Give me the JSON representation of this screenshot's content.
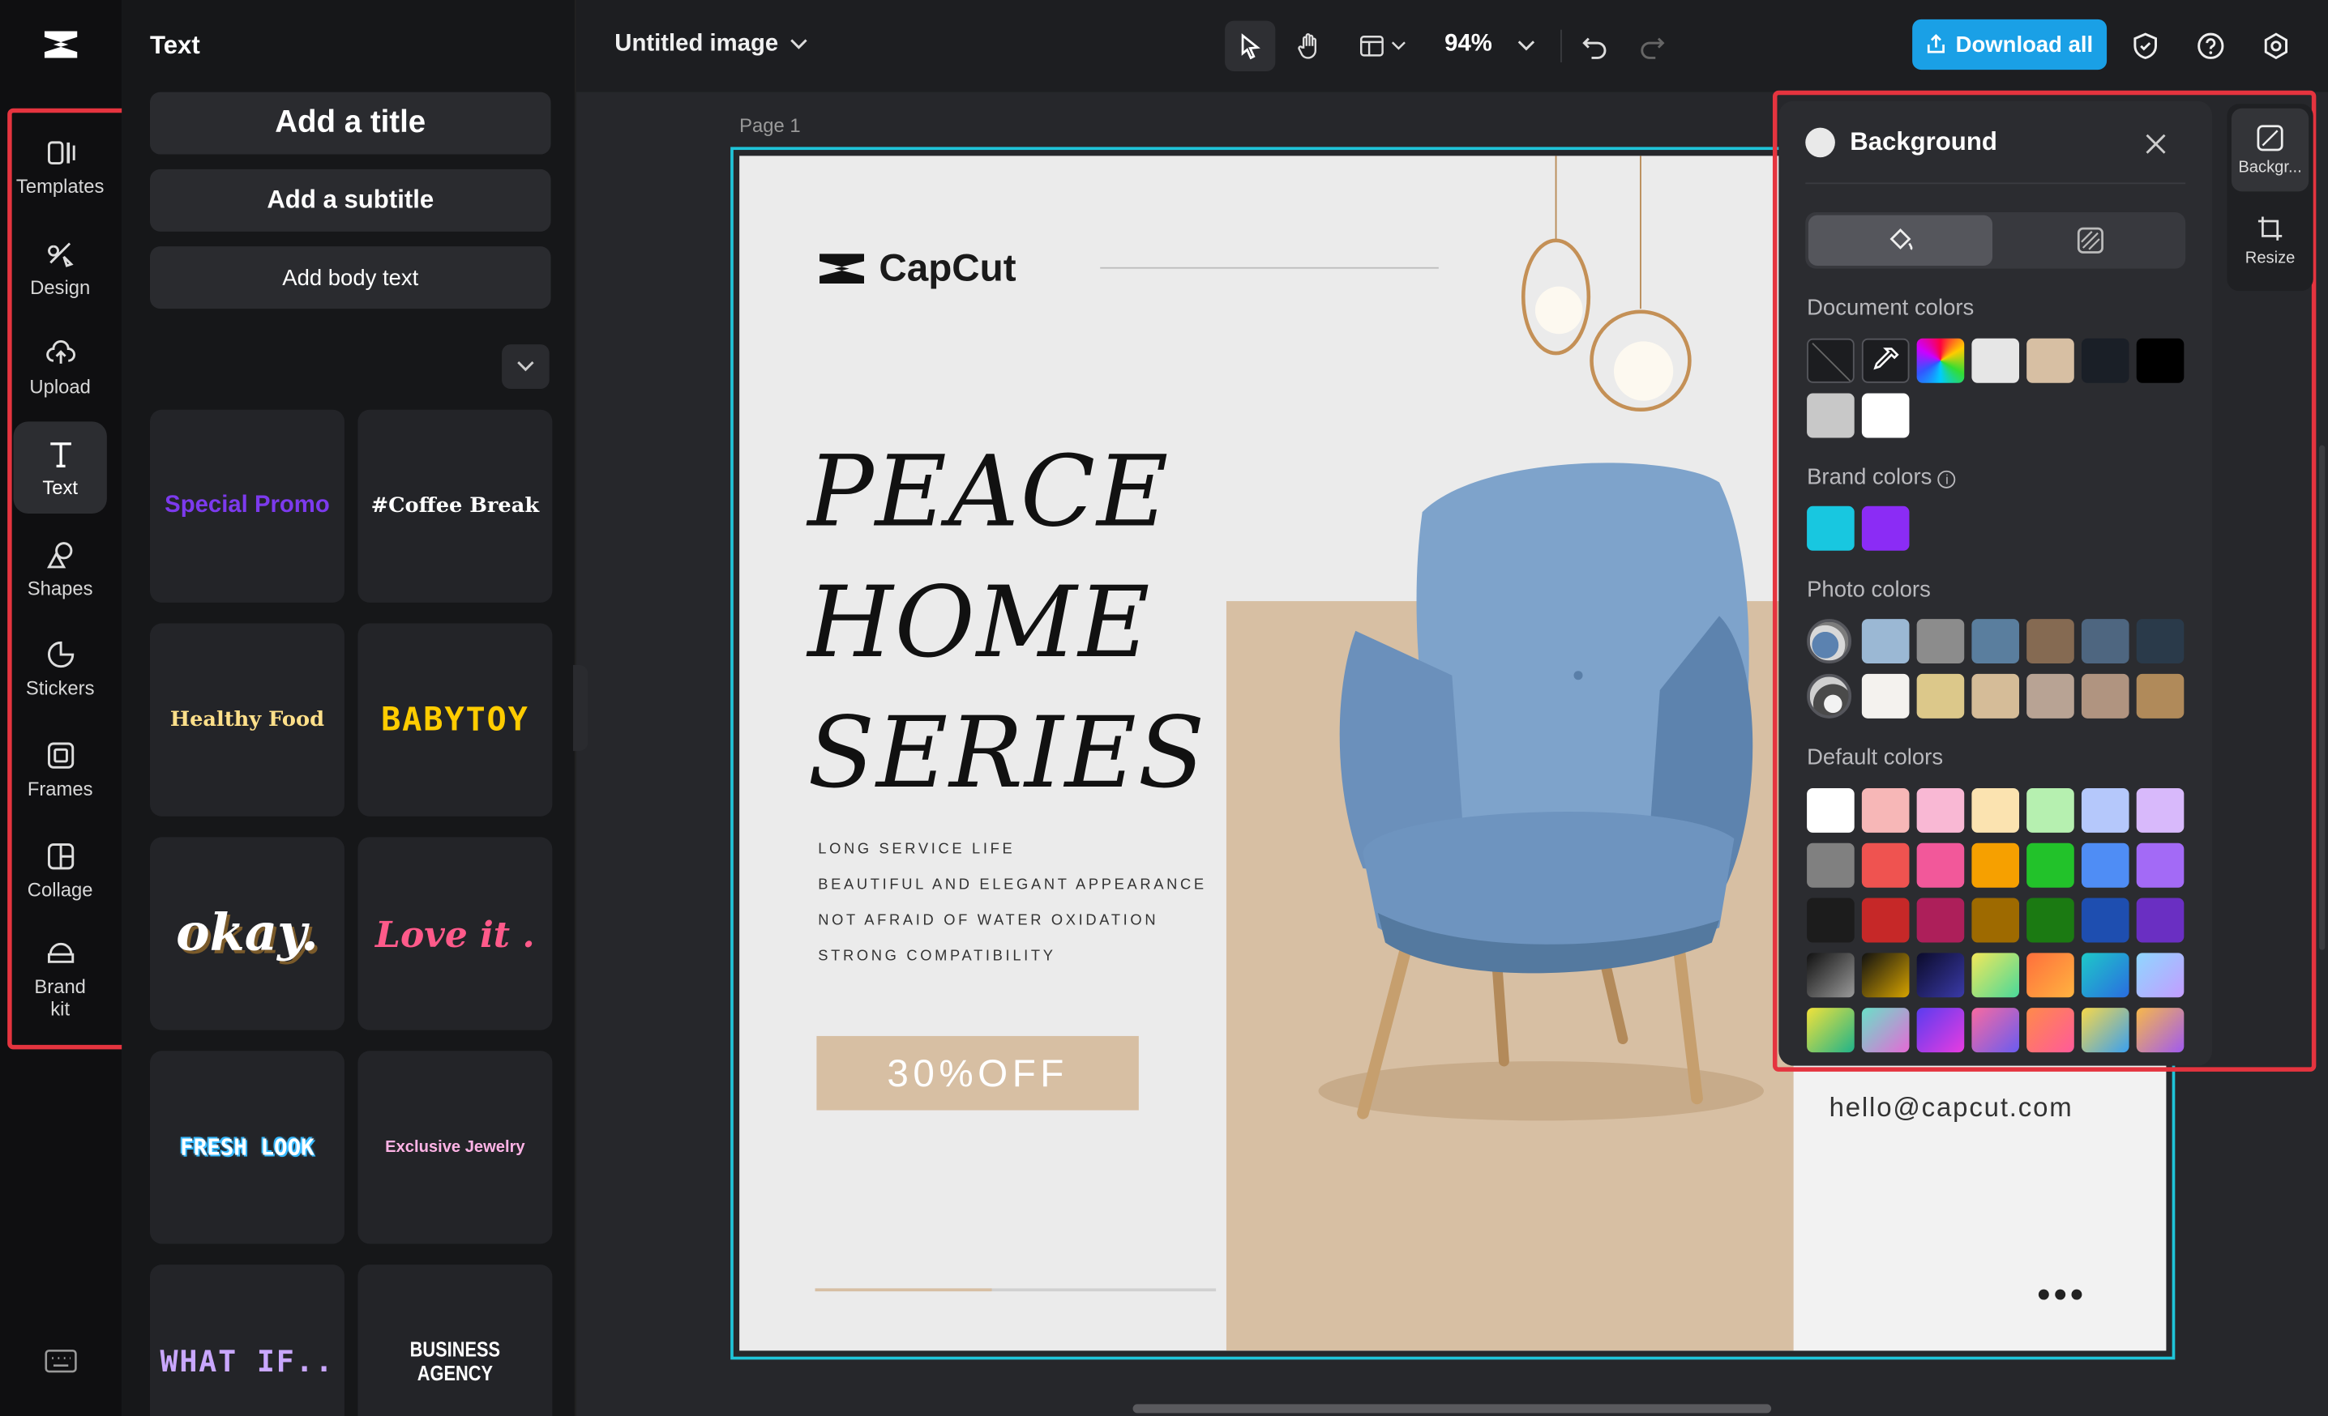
{
  "rail": {
    "items": [
      {
        "label": "Templates",
        "icon": "templates-icon"
      },
      {
        "label": "Design",
        "icon": "design-icon"
      },
      {
        "label": "Upload",
        "icon": "upload-icon"
      },
      {
        "label": "Text",
        "icon": "text-icon"
      },
      {
        "label": "Shapes",
        "icon": "shapes-icon"
      },
      {
        "label": "Stickers",
        "icon": "stickers-icon"
      },
      {
        "label": "Frames",
        "icon": "frames-icon"
      },
      {
        "label": "Collage",
        "icon": "collage-icon"
      },
      {
        "label": "Brand\nkit",
        "icon": "brand-kit-icon"
      }
    ],
    "active": "Text"
  },
  "text_panel": {
    "title": "Text",
    "add_title": "Add a title",
    "add_subtitle": "Add a subtitle",
    "add_body": "Add body text",
    "presets": [
      {
        "label": "Special Promo",
        "color": "#7c3aed"
      },
      {
        "label": "#Coffee Break",
        "color": "#ffffff"
      },
      {
        "label": "Healthy Food",
        "color": "#ffe08a"
      },
      {
        "label": "BABYTOY",
        "color": "#ffcc00"
      },
      {
        "label": "okay.",
        "color": "#ffffff"
      },
      {
        "label": "Love it .",
        "color": "#ff5a8a"
      },
      {
        "label": "FRESH LOOK",
        "color": "#7fe3ff"
      },
      {
        "label": "Exclusive Jewelry",
        "color": "#ffb3e6"
      },
      {
        "label": "WHAT IF..",
        "color": "#c9a7ff"
      },
      {
        "label": "BUSINESS AGENCY",
        "color": "#ffffff"
      }
    ]
  },
  "topbar": {
    "doc_title": "Untitled image",
    "zoom": "94%",
    "download_label": "Download all",
    "accent": "#1aa0e6"
  },
  "canvas": {
    "page_label": "Page 1",
    "brand_name": "CapCut",
    "headline": [
      "PEACE",
      "HOME",
      "SERIES"
    ],
    "features": [
      "LONG SERVICE LIFE",
      "BEAUTIFUL AND ELEGANT APPEARANCE",
      "NOT AFRAID OF WATER OXIDATION",
      "STRONG COMPATIBILITY"
    ],
    "offer": "30%OFF",
    "email": "hello@capcut.com",
    "more": "•••",
    "progress": 0.44
  },
  "background_panel": {
    "title": "Background",
    "document_colors_label": "Document colors",
    "document_colors": [
      "none",
      "picker",
      "rainbow",
      "#e6e6e6",
      "#d7bfa3",
      "#1a1f27",
      "#000000",
      "#c8c8c8",
      "#ffffff"
    ],
    "brand_colors_label": "Brand colors",
    "brand_colors": [
      "#18c7e0",
      "#8b2cf5"
    ],
    "photo_colors_label": "Photo colors",
    "photo_colors": [
      [
        "photo",
        "#9bb8d4",
        "#8c8c8c",
        "#5a7e9e",
        "#856a52",
        "#4e6680",
        "#2a3a4a"
      ],
      [
        "photo2",
        "#f4f2ee",
        "#dcc88a",
        "#d5bc98",
        "#b8a394",
        "#b09480",
        "#b08a5a"
      ]
    ],
    "default_colors_label": "Default colors",
    "default_colors": [
      [
        "#ffffff",
        "#f7b7b7",
        "#f9b8d4",
        "#fbe3b0",
        "#b6f0b0",
        "#b5c8fb",
        "#d8b9fb"
      ],
      [
        "#808080",
        "#ef5350",
        "#f2589a",
        "#f6a000",
        "#22c22a",
        "#4f8df5",
        "#a36af6"
      ],
      [
        "#1c1c1c",
        "#c62828",
        "#ad1f5a",
        "#9e6a00",
        "#1b7a12",
        "#1e4eb0",
        "#6a2fc2"
      ],
      [
        "g:#111111,#9a9a9a",
        "g:#111111,#d6a300",
        "g:#0b0b2a,#3a3aa8",
        "g:#f2e85a,#4ad89a",
        "g:#ff6f3c,#ffb340",
        "g:#1ec8c8,#2a6de0",
        "g:#8fd7ff,#c39cff"
      ],
      [
        "g:#f2e23a,#1fb38a",
        "g:#6ae0c8,#e46ad6",
        "g:#5a3cf0,#e83ce0",
        "g:#f86aa0,#6a5cf0",
        "g:#ff8a4a,#ff5a9a",
        "g:#f7d84a,#3aa0f0",
        "g:#f7b84a,#a05af0"
      ]
    ]
  },
  "side_tabs": [
    {
      "label": "Backgr...",
      "icon": "background-icon"
    },
    {
      "label": "Resize",
      "icon": "resize-icon"
    }
  ]
}
